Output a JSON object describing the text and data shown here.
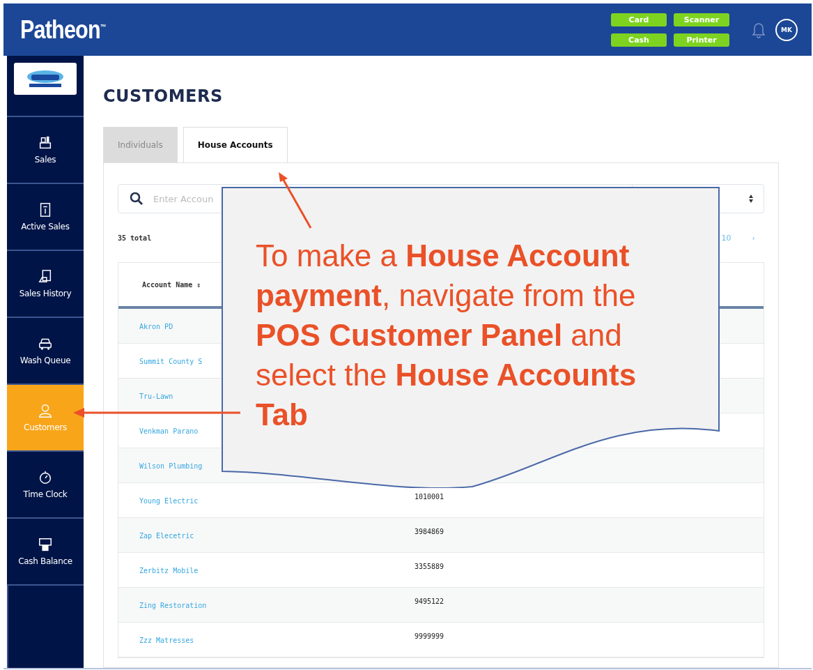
{
  "header": {
    "brand": "Patheon",
    "brand_mark": "™",
    "status_buttons": [
      "Card",
      "Scanner",
      "Cash",
      "Printer"
    ],
    "avatar": "MK"
  },
  "sidebar": {
    "items": [
      {
        "label": "Sales",
        "selected": false
      },
      {
        "label": "Active Sales",
        "selected": false
      },
      {
        "label": "Sales History",
        "selected": false
      },
      {
        "label": "Wash Queue",
        "selected": false
      },
      {
        "label": "Customers",
        "selected": true
      },
      {
        "label": "Time Clock",
        "selected": false
      },
      {
        "label": "Cash Balance",
        "selected": false
      }
    ]
  },
  "page": {
    "title": "CUSTOMERS",
    "tabs": [
      {
        "label": "Individuals",
        "selected": false
      },
      {
        "label": "House Accounts",
        "selected": true
      }
    ],
    "search": {
      "placeholder": "Enter Accoun"
    },
    "total": "35 total",
    "pagination": [
      "10",
      "›"
    ],
    "table": {
      "columns": [
        "Account Name ⇕"
      ],
      "rows": [
        {
          "name": "Akron PD"
        },
        {
          "name": "Summit County S"
        },
        {
          "name": "Tru-Lawn"
        },
        {
          "name": "Venkman Parano"
        },
        {
          "name": "Wilson Plumbing"
        },
        {
          "name": "Young Electric",
          "id": "1010001"
        },
        {
          "name": "Zap Elecetric",
          "id": "3984869"
        },
        {
          "name": "Zerbitz Mobile",
          "id": "3355889"
        },
        {
          "name": "Zing Restoration",
          "id": "9495122"
        },
        {
          "name": "Zzz Matresses",
          "id": "9999999"
        }
      ]
    }
  },
  "callout": {
    "text": "To make a **House Account payment**, navigate from the **POS Customer Panel** and select the **House Accounts Tab**"
  }
}
